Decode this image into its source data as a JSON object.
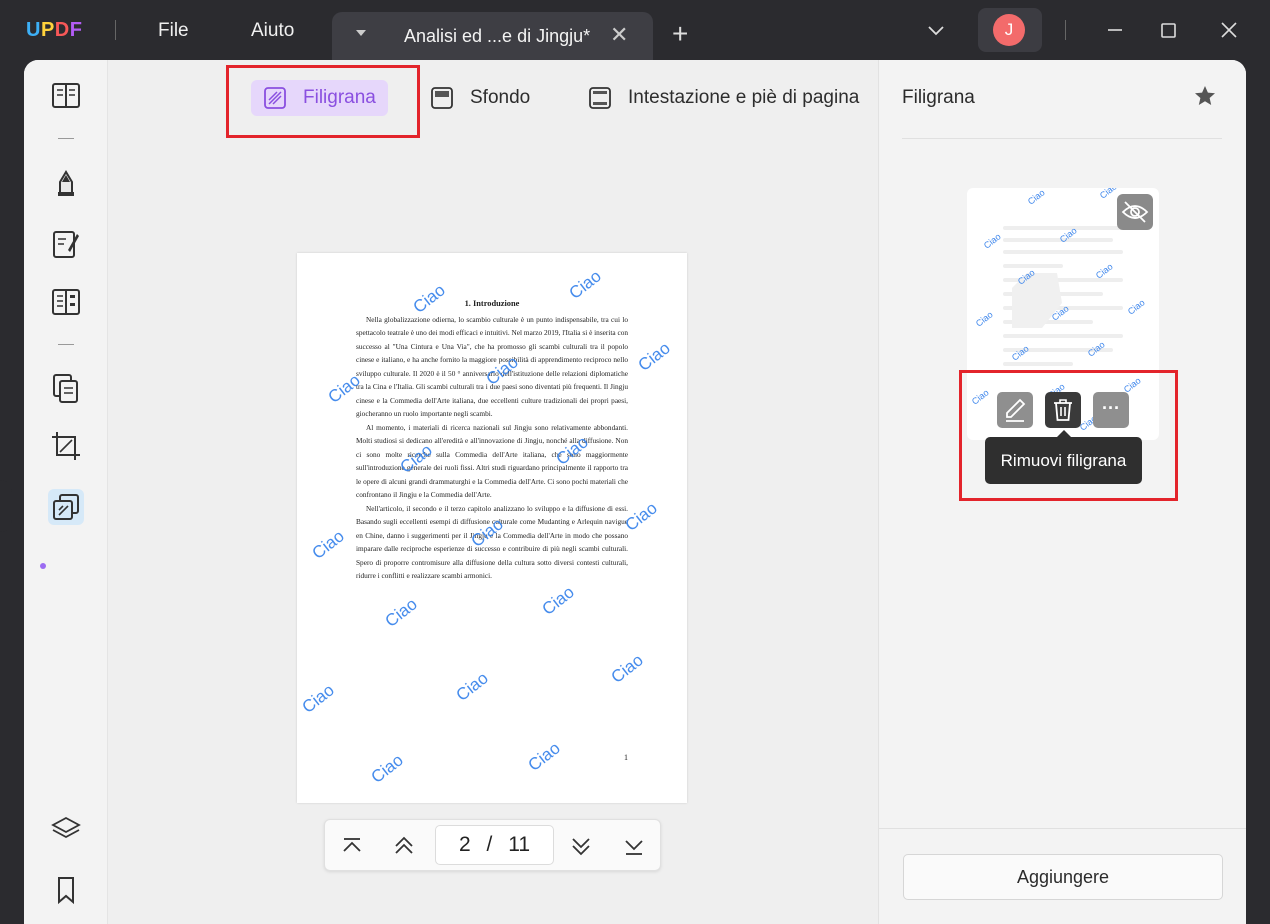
{
  "app": {
    "logo": {
      "u": "U",
      "p": "P",
      "d": "D",
      "f": "F"
    },
    "menu": {
      "file": "File",
      "help": "Aiuto"
    },
    "tab_title": "Analisi ed ...e di Jingju*",
    "tab_close": "✕",
    "new_tab": "+",
    "avatar_initial": "J"
  },
  "toolbar": {
    "watermark": "Filigrana",
    "background": "Sfondo",
    "header_footer": "Intestazione e piè di pagina"
  },
  "document": {
    "heading": "1. Introduzione",
    "paragraphs": [
      "Nella globalizzazione odierna, lo scambio culturale è un punto indispensabile, tra cui lo spettacolo teatrale è uno dei modi efficaci e intuitivi. Nel marzo 2019, l'Italia si è inserita con successo al \"Una Cintura e Una Via\", che ha promosso gli scambi culturali tra il popolo cinese e italiano, e ha anche fornito la maggiore possibilità di apprendimento reciproco nello sviluppo culturale. Il 2020 è il 50 ° anniversario dell'istituzione delle relazioni diplomatiche tra la Cina e l'Italia. Gli scambi culturali tra i due paesi sono diventati più frequenti. Il Jingju cinese e la Commedia dell'Arte italiana, due eccellenti culture tradizionali dei propri paesi, giocheranno un ruolo importante negli scambi.",
      "Al momento, i materiali di ricerca nazionali sul Jingju sono relativamente abbondanti. Molti studiosi si dedicano all'eredità e all'innovazione di Jingju, nonché alla diffusione. Non ci sono molte ricerche sulla Commedia dell'Arte italiana, che sono maggiormente sull'introduzione generale dei ruoli fissi. Altri studi riguardano principalmente il rapporto tra le opere di alcuni grandi drammaturghi e la Commedia dell'Arte. Ci sono pochi materiali che confrontano il Jingju e la Commedia dell'Arte.",
      "Nell'articolo, il secondo e il terzo capitolo analizzano lo sviluppo e la diffusione di essi. Basando sugli eccellenti esempi di diffusione culturale come Mudanting e Arlequin navigue en Chine, danno i suggerimenti per il Jingju e la Commedia dell'Arte in modo che possano imparare dalle reciproche esperienze di successo e contribuire di più negli scambi culturali. Spero di proporre contromisure alla diffusione della cultura sotto diversi contesti culturali, ridurre i conflitti e realizzare scambi armonici."
    ],
    "page_number": "1",
    "watermark_text": "Ciao"
  },
  "pagination": {
    "current": "2",
    "separator": "/",
    "total": "11"
  },
  "panel": {
    "title": "Filigrana",
    "tooltip": "Rimuovi filigrana",
    "add_button": "Aggiungere",
    "more": "···"
  },
  "colors": {
    "accent": "#8a4fe0",
    "highlight_box": "#e3242b",
    "watermark": "#3d86ec",
    "avatar": "#f36b6b"
  }
}
